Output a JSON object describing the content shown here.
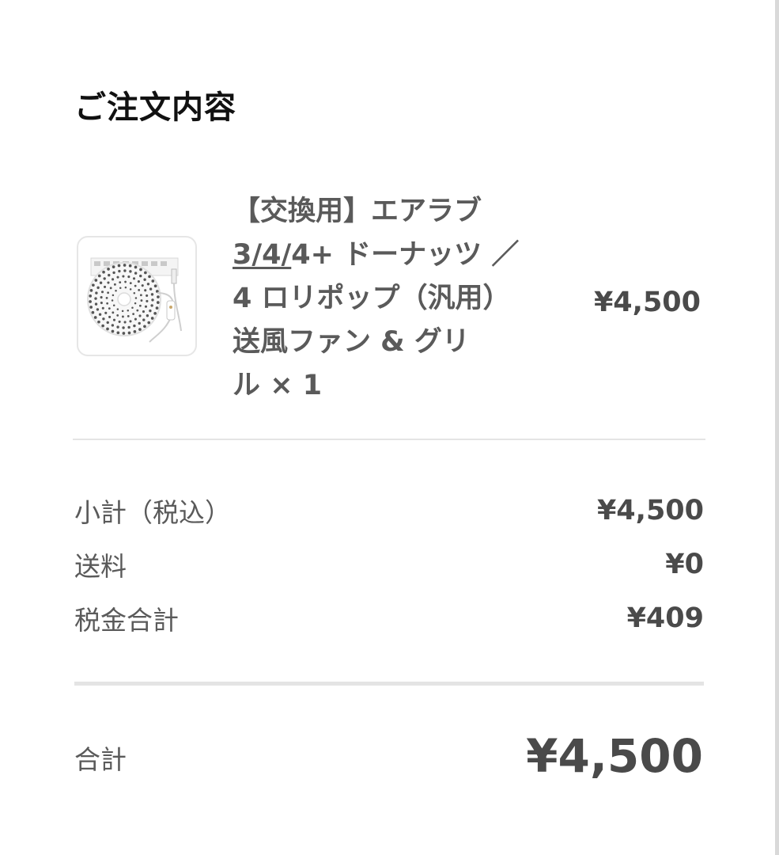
{
  "order": {
    "title": "ご注文内容",
    "item": {
      "name_line1": "【交換用】エアラブ",
      "name_line2_underlined": "3/4/",
      "name_line2_rest": "4+ ドーナッツ ／",
      "name_line3": "4 ロリポップ（汎用）",
      "name_line4": "送風ファン & グリ",
      "name_line5": "ル",
      "quantity": "× 1",
      "price": "¥4,500",
      "image_icon": "fan-product-photo"
    },
    "summary": {
      "subtotal_label": "小計（税込）",
      "subtotal_value": "¥4,500",
      "shipping_label": "送料",
      "shipping_value": "¥0",
      "tax_label": "税金合計",
      "tax_value": "¥409"
    },
    "total": {
      "label": "合計",
      "value": "¥4,500"
    }
  }
}
